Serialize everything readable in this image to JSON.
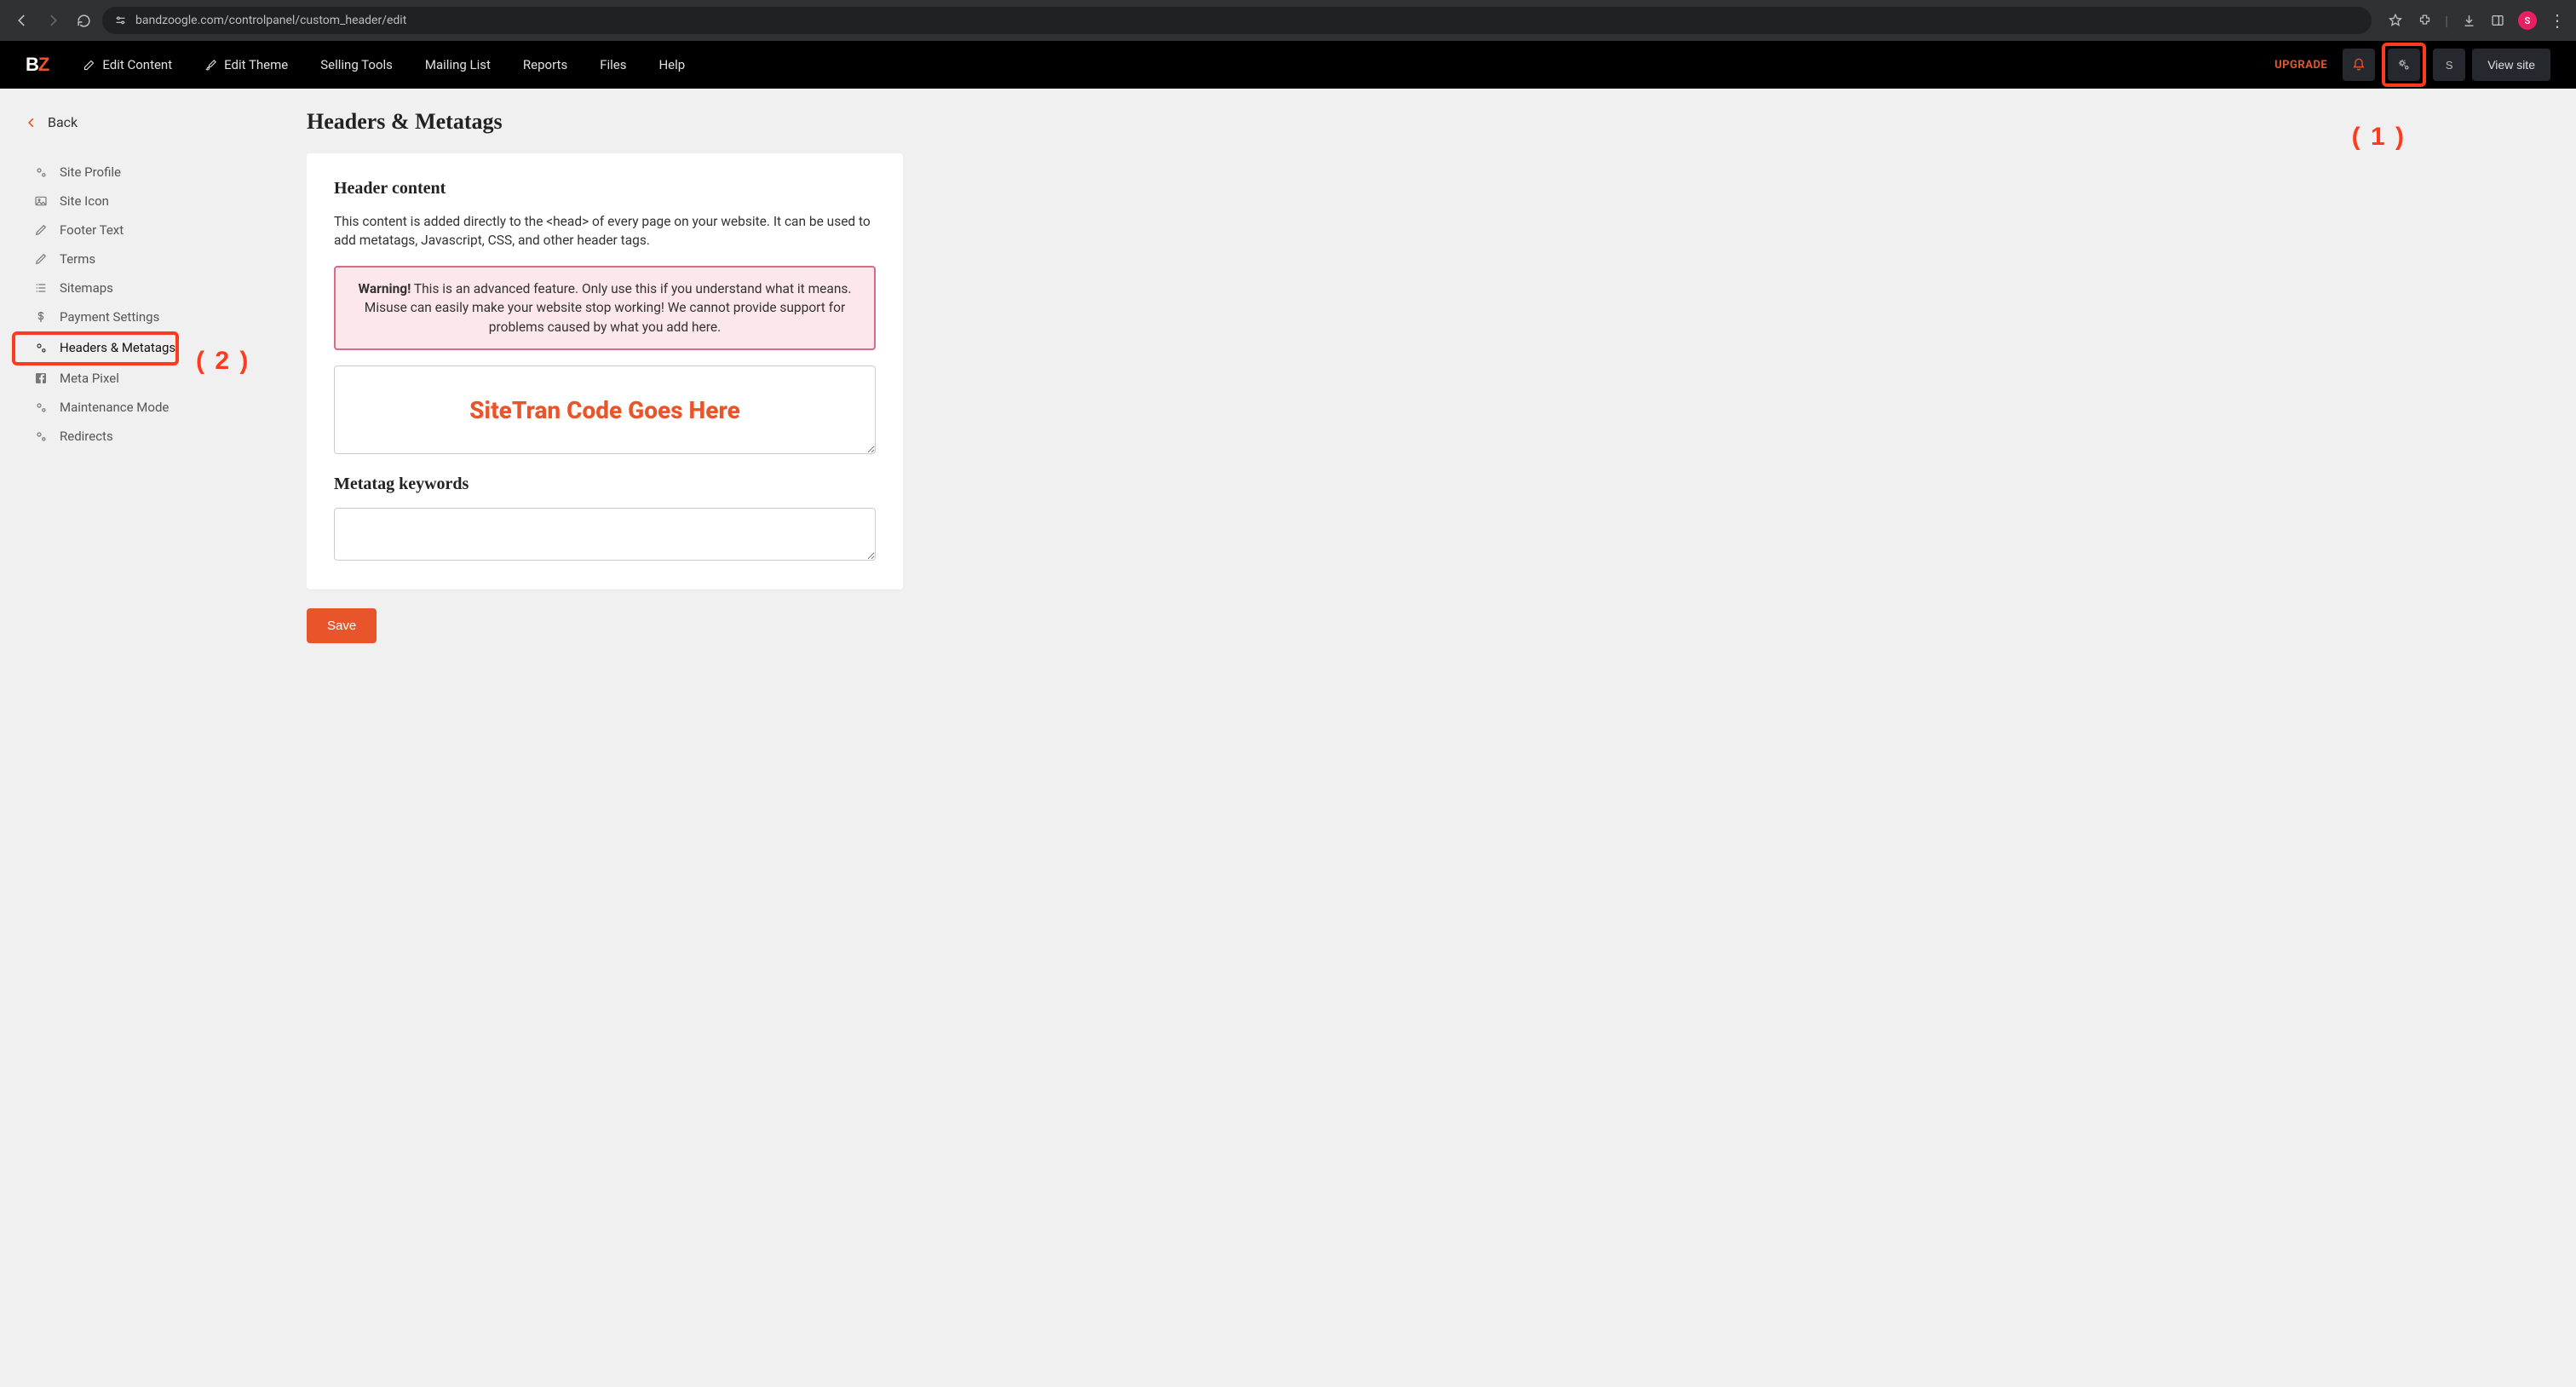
{
  "browser": {
    "url": "bandzoogle.com/controlpanel/custom_header/edit",
    "avatar_letter": "S"
  },
  "top_nav": {
    "edit_content": "Edit Content",
    "edit_theme": "Edit Theme",
    "selling_tools": "Selling Tools",
    "mailing_list": "Mailing List",
    "reports": "Reports",
    "files": "Files",
    "help": "Help",
    "upgrade": "UPGRADE",
    "s_letter": "S",
    "view_site": "View site"
  },
  "sidebar": {
    "back": "Back",
    "items": [
      "Site Profile",
      "Site Icon",
      "Footer Text",
      "Terms",
      "Sitemaps",
      "Payment Settings",
      "Headers & Metatags",
      "Meta Pixel",
      "Maintenance Mode",
      "Redirects"
    ]
  },
  "page": {
    "title": "Headers & Metatags",
    "header_content_h": "Header content",
    "header_content_p": "This content is added directly to the <head> of every page on your website. It can be used to add metatags, Javascript, CSS, and other header tags.",
    "warning_strong": "Warning!",
    "warning_text": " This is an advanced feature. Only use this if you understand what it means. Misuse can easily make your website stop working! We cannot provide support for problems caused by what you add here.",
    "code_placeholder_overlay": "SiteTran Code Goes Here",
    "metatag_h": "Metatag keywords",
    "save": "Save"
  },
  "annotations": {
    "one": "( 1 )",
    "two": "( 2 )"
  }
}
